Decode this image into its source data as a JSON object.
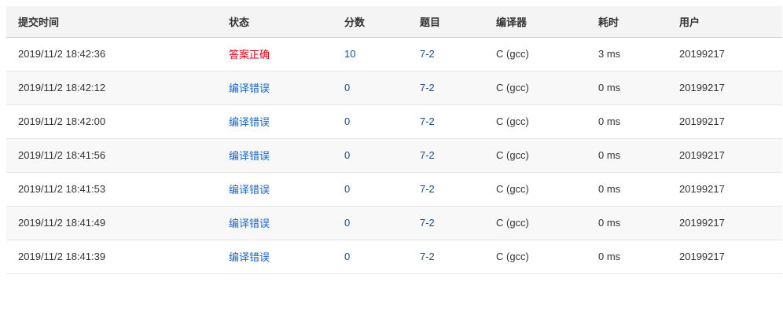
{
  "columns": [
    "提交时间",
    "状态",
    "分数",
    "题目",
    "编译器",
    "耗时",
    "用户"
  ],
  "rows": [
    {
      "time": "2019/11/2 18:42:36",
      "status": "答案正确",
      "score": "10",
      "problem": "7-2",
      "compiler": "C (gcc)",
      "elapsed": "3 ms",
      "user": "20199217"
    },
    {
      "time": "2019/11/2 18:42:12",
      "status": "编译错误",
      "score": "0",
      "problem": "7-2",
      "compiler": "C (gcc)",
      "elapsed": "0 ms",
      "user": "20199217"
    },
    {
      "time": "2019/11/2 18:42:00",
      "status": "编译错误",
      "score": "0",
      "problem": "7-2",
      "compiler": "C (gcc)",
      "elapsed": "0 ms",
      "user": "20199217"
    },
    {
      "time": "2019/11/2 18:41:56",
      "status": "编译错误",
      "score": "0",
      "problem": "7-2",
      "compiler": "C (gcc)",
      "elapsed": "0 ms",
      "user": "20199217"
    },
    {
      "time": "2019/11/2 18:41:53",
      "status": "编译错误",
      "score": "0",
      "problem": "7-2",
      "compiler": "C (gcc)",
      "elapsed": "0 ms",
      "user": "20199217"
    },
    {
      "time": "2019/11/2 18:41:49",
      "status": "编译错误",
      "score": "0",
      "problem": "7-2",
      "compiler": "C (gcc)",
      "elapsed": "0 ms",
      "user": "20199217"
    },
    {
      "time": "2019/11/2 18:41:39",
      "status": "编译错误",
      "score": "0",
      "problem": "7-2",
      "compiler": "C (gcc)",
      "elapsed": "0 ms",
      "user": "20199217"
    }
  ],
  "colors": {
    "accepted": "#d9001b",
    "compile_error": "#1a66c9",
    "link": "#1a4f8f",
    "header_bg": "#f4f4f5",
    "alt_row_bg": "#f8f8f8"
  }
}
